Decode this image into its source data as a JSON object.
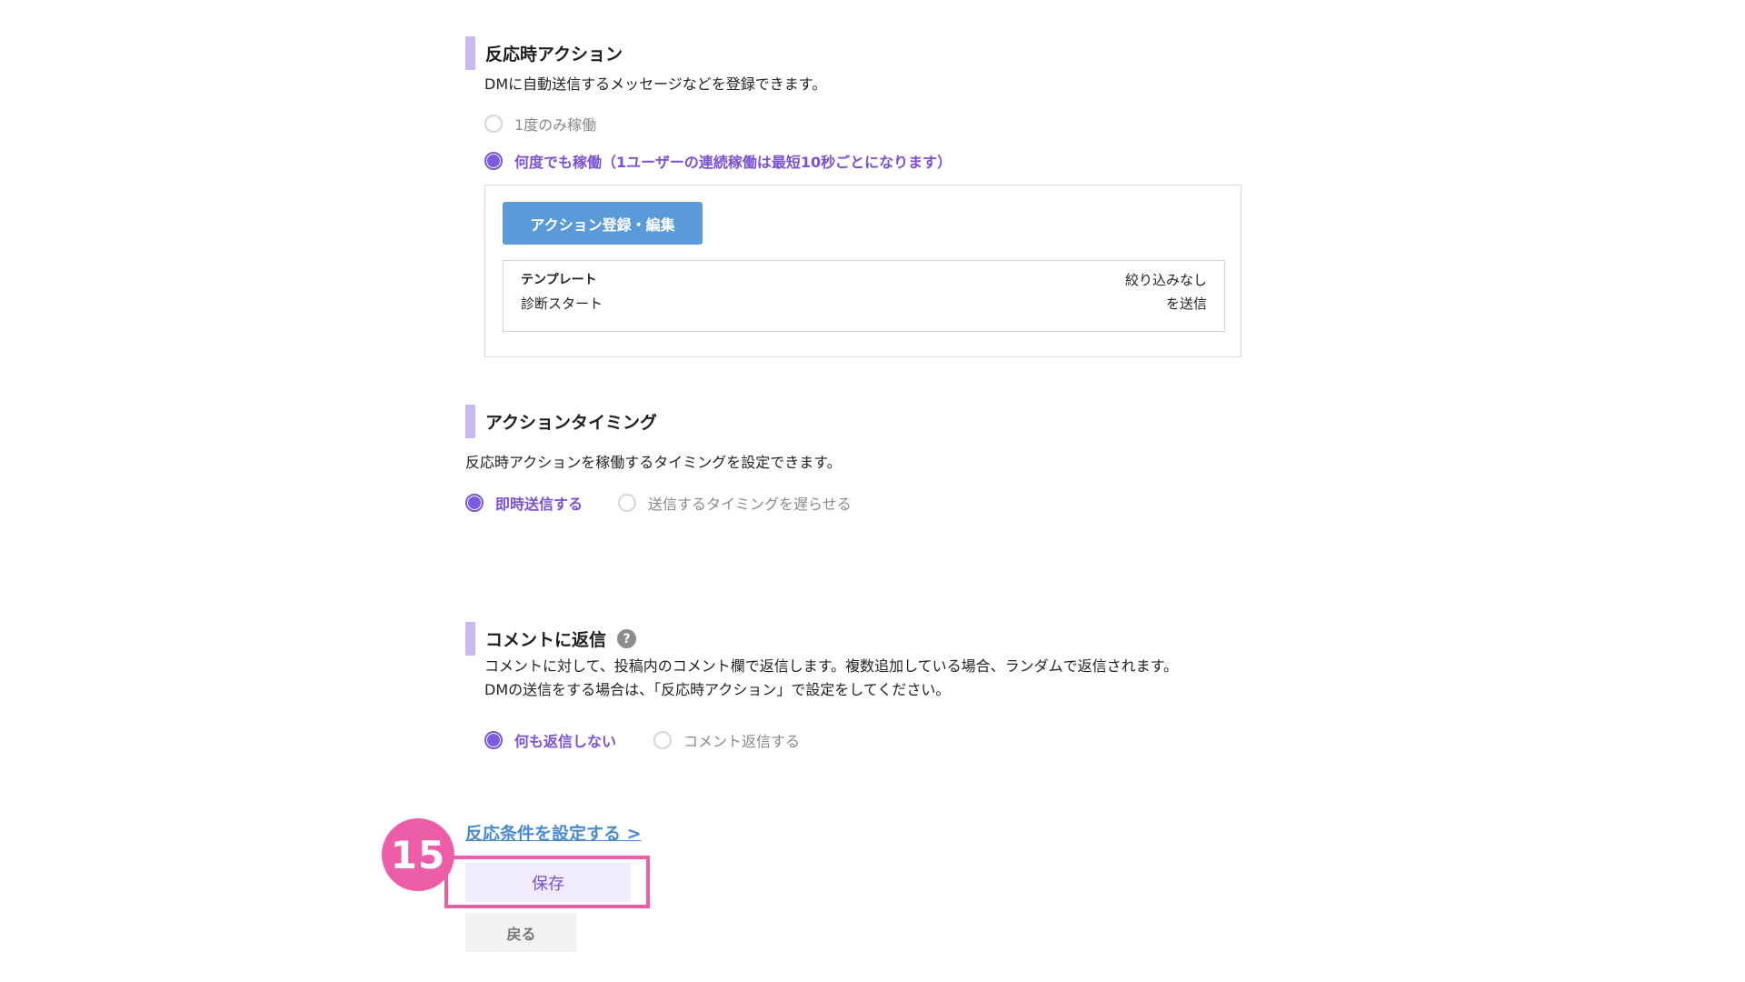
{
  "reaction_action": {
    "title": "反応時アクション",
    "description": "DMに自動送信するメッセージなどを登録できます。",
    "options": [
      {
        "label": "1度のみ稼働",
        "selected": false
      },
      {
        "label": "何度でも稼働（1ユーザーの連続稼働は最短10秒ごとになります）",
        "selected": true
      }
    ],
    "register_button": "アクション登録・編集",
    "template": {
      "line1": "テンプレート",
      "line2": "診断スタート",
      "filter_line1": "絞り込みなし",
      "filter_line2": "を送信"
    }
  },
  "action_timing": {
    "title": "アクションタイミング",
    "description": "反応時アクションを稼働するタイミングを設定できます。",
    "options": [
      {
        "label": "即時送信する",
        "selected": true
      },
      {
        "label": "送信するタイミングを遅らせる",
        "selected": false
      }
    ]
  },
  "comment_reply": {
    "title": "コメントに返信",
    "help_icon": "?",
    "description_line1": "コメントに対して、投稿内のコメント欄で返信します。複数追加している場合、ランダムで返信されます。",
    "description_line2": "DMの送信をする場合は、「反応時アクション」で設定をしてください。",
    "options": [
      {
        "label": "何も返信しない",
        "selected": true
      },
      {
        "label": "コメント返信する",
        "selected": false
      }
    ]
  },
  "footer": {
    "condition_link": "反応条件を設定する >",
    "step_badge": "15",
    "save_button": "保存",
    "back_button": "戻る"
  },
  "colors": {
    "accent_purple": "#7b4fd6",
    "title_bar": "#c9b8f2",
    "blue_button": "#5b9ad8",
    "highlight_pink": "#ee5ea8",
    "link_blue": "#4a8bd0"
  }
}
